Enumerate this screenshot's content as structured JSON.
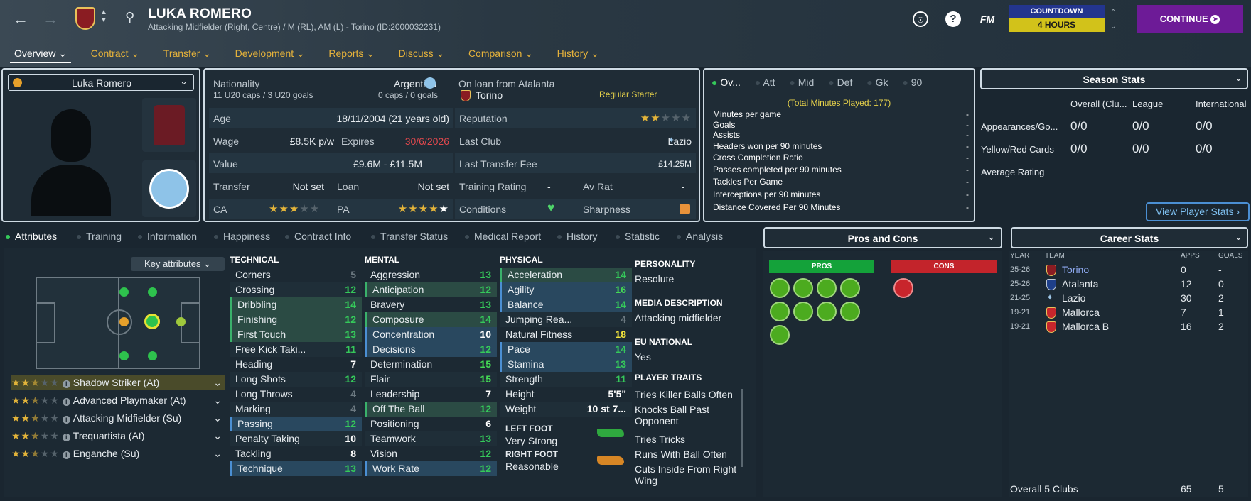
{
  "header": {
    "player_name": "LUKA ROMERO",
    "subtitle": "Attacking Midfielder (Right, Centre) / M (RL), AM (L) - Torino (ID:2000032231)",
    "help": "?",
    "fm": "FM",
    "countdown_label": "COUNTDOWN",
    "countdown_value": "4 HOURS",
    "continue_label": "CONTINUE"
  },
  "tabs": [
    "Overview",
    "Contract",
    "Transfer",
    "Development",
    "Reports",
    "Discuss",
    "Comparison",
    "History"
  ],
  "profile": {
    "name": "Luka Romero"
  },
  "info": {
    "nationality_label": "Nationality",
    "nationality": "Argentina",
    "caps_u20": "11 U20 caps / 3 U20 goals",
    "caps": "0 caps / 0 goals",
    "loan_label": "On loan from Atalanta",
    "loan_club": "Torino",
    "status": "Regular Starter",
    "age_label": "Age",
    "age": "18/11/2004 (21 years old)",
    "wage_label": "Wage",
    "wage": "£8.5K p/w",
    "expires_label": "Expires",
    "expires": "30/6/2026",
    "value_label": "Value",
    "value": "£9.6M - £11.5M",
    "transfer_label": "Transfer",
    "transfer": "Not set",
    "loan_label2": "Loan",
    "loan": "Not set",
    "ca_label": "CA",
    "pa_label": "PA",
    "ca_stars": 3,
    "pa_stars": 5,
    "reputation_label": "Reputation",
    "reputation_stars": 2.5,
    "last_club_label": "Last Club",
    "last_club": "Lazio",
    "last_fee_label": "Last Transfer Fee",
    "last_fee": "£14.25M",
    "training_label": "Training Rating",
    "training": "-",
    "avrat_label": "Av Rat",
    "avrat": "-",
    "conditions_label": "Conditions",
    "sharpness_label": "Sharpness"
  },
  "stats_tabs": [
    "Ov...",
    "Att",
    "Mid",
    "Def",
    "Gk",
    "90"
  ],
  "stats": {
    "total": "(Total Minutes Played: 177)",
    "lines": [
      {
        "label": "Minutes per game",
        "value": "-"
      },
      {
        "label": "Goals",
        "value": "-"
      },
      {
        "label": "Assists",
        "value": "-"
      },
      {
        "label": "Headers won per 90 minutes",
        "value": "-"
      },
      {
        "label": "Cross Completion Ratio",
        "value": "-"
      },
      {
        "label": "Passes completed per 90 minutes",
        "value": "-"
      },
      {
        "label": "Tackles Per Game",
        "value": "-"
      },
      {
        "label": "Interceptions per 90 minutes",
        "value": "-"
      },
      {
        "label": "Distance Covered Per 90 Minutes",
        "value": "-"
      }
    ]
  },
  "season": {
    "title": "Season Stats",
    "cols": [
      "Overall (Clu...",
      "League",
      "International"
    ],
    "rows": [
      {
        "label": "Appearances/Go...",
        "values": [
          "0/0",
          "0/0",
          "0/0"
        ]
      },
      {
        "label": "Yellow/Red Cards",
        "values": [
          "0/0",
          "0/0",
          "0/0"
        ]
      },
      {
        "label": "Average Rating",
        "values": [
          "–",
          "–",
          "–"
        ]
      }
    ],
    "button": "View Player Stats"
  },
  "subtabs": [
    "Attributes",
    "Training",
    "Information",
    "Happiness",
    "Contract Info",
    "Transfer Status",
    "Medical Report",
    "History",
    "Statistic",
    "Analysis"
  ],
  "key_attributes": "Key attributes",
  "roles": [
    {
      "name": "Shadow Striker (At)",
      "stars": 2.5
    },
    {
      "name": "Advanced Playmaker (At)",
      "stars": 2.5
    },
    {
      "name": "Attacking Midfielder (Su)",
      "stars": 2.5
    },
    {
      "name": "Trequartista (At)",
      "stars": 2.5
    },
    {
      "name": "Enganche (Su)",
      "stars": 2.5
    }
  ],
  "attributes": {
    "technical": {
      "title": "TECHNICAL",
      "items": [
        {
          "n": "Corners",
          "v": "5",
          "s": ""
        },
        {
          "n": "Crossing",
          "v": "12",
          "s": ""
        },
        {
          "n": "Dribbling",
          "v": "14",
          "s": "grn"
        },
        {
          "n": "Finishing",
          "v": "12",
          "s": "grn"
        },
        {
          "n": "First Touch",
          "v": "13",
          "s": "grn"
        },
        {
          "n": "Free Kick Taki...",
          "v": "11",
          "s": ""
        },
        {
          "n": "Heading",
          "v": "7",
          "s": ""
        },
        {
          "n": "Long Shots",
          "v": "12",
          "s": ""
        },
        {
          "n": "Long Throws",
          "v": "4",
          "s": ""
        },
        {
          "n": "Marking",
          "v": "4",
          "s": ""
        },
        {
          "n": "Passing",
          "v": "12",
          "s": "blue"
        },
        {
          "n": "Penalty Taking",
          "v": "10",
          "s": ""
        },
        {
          "n": "Tackling",
          "v": "8",
          "s": ""
        },
        {
          "n": "Technique",
          "v": "13",
          "s": "blue"
        }
      ]
    },
    "mental": {
      "title": "MENTAL",
      "items": [
        {
          "n": "Aggression",
          "v": "13",
          "s": ""
        },
        {
          "n": "Anticipation",
          "v": "12",
          "s": "grn"
        },
        {
          "n": "Bravery",
          "v": "13",
          "s": ""
        },
        {
          "n": "Composure",
          "v": "14",
          "s": "grn"
        },
        {
          "n": "Concentration",
          "v": "10",
          "s": "blue"
        },
        {
          "n": "Decisions",
          "v": "12",
          "s": "blue"
        },
        {
          "n": "Determination",
          "v": "15",
          "s": ""
        },
        {
          "n": "Flair",
          "v": "15",
          "s": ""
        },
        {
          "n": "Leadership",
          "v": "7",
          "s": ""
        },
        {
          "n": "Off The Ball",
          "v": "12",
          "s": "grn"
        },
        {
          "n": "Positioning",
          "v": "6",
          "s": ""
        },
        {
          "n": "Teamwork",
          "v": "13",
          "s": ""
        },
        {
          "n": "Vision",
          "v": "12",
          "s": ""
        },
        {
          "n": "Work Rate",
          "v": "12",
          "s": "blue"
        }
      ]
    },
    "physical": {
      "title": "PHYSICAL",
      "items": [
        {
          "n": "Acceleration",
          "v": "14",
          "s": "grn"
        },
        {
          "n": "Agility",
          "v": "16",
          "s": "blue"
        },
        {
          "n": "Balance",
          "v": "14",
          "s": "blue"
        },
        {
          "n": "Jumping Rea...",
          "v": "4",
          "s": ""
        },
        {
          "n": "Natural Fitness",
          "v": "18",
          "s": ""
        },
        {
          "n": "Pace",
          "v": "14",
          "s": "blue"
        },
        {
          "n": "Stamina",
          "v": "13",
          "s": "blue"
        },
        {
          "n": "Strength",
          "v": "11",
          "s": ""
        },
        {
          "n": "Height",
          "v": "5'5\"",
          "s": ""
        },
        {
          "n": "Weight",
          "v": "10 st 7...",
          "s": ""
        }
      ]
    }
  },
  "foot": {
    "left_label": "LEFT FOOT",
    "left": "Very Strong",
    "right_label": "RIGHT FOOT",
    "right": "Reasonable"
  },
  "personality": {
    "label": "PERSONALITY",
    "value": "Resolute",
    "media_label": "MEDIA DESCRIPTION",
    "media": "Attacking midfielder",
    "eu_label": "EU NATIONAL",
    "eu": "Yes",
    "traits_label": "PLAYER TRAITS",
    "traits": [
      "Tries Killer Balls Often",
      "Knocks Ball Past Opponent",
      "Tries Tricks",
      "Runs With Ball Often",
      "Cuts Inside From Right Wing"
    ]
  },
  "pros_cons": {
    "title": "Pros and Cons",
    "pros": "PROS",
    "cons": "CONS"
  },
  "career": {
    "title": "Career Stats",
    "cols": [
      "YEAR",
      "TEAM",
      "APPS",
      "GOALS"
    ],
    "rows": [
      {
        "year": "25-26",
        "team": "Torino",
        "apps": "0",
        "goals": "-"
      },
      {
        "year": "25-26",
        "team": "Atalanta",
        "apps": "12",
        "goals": "0"
      },
      {
        "year": "21-25",
        "team": "Lazio",
        "apps": "30",
        "goals": "2"
      },
      {
        "year": "19-21",
        "team": "Mallorca",
        "apps": "7",
        "goals": "1"
      },
      {
        "year": "19-21",
        "team": "Mallorca B",
        "apps": "16",
        "goals": "2"
      }
    ],
    "total_label": "Overall 5 Clubs",
    "total_apps": "65",
    "total_goals": "5"
  },
  "colors": {
    "accent_gold": "#e5b23b",
    "continue": "#6d1b97",
    "pros": "#14a23a",
    "cons": "#c3242b"
  }
}
